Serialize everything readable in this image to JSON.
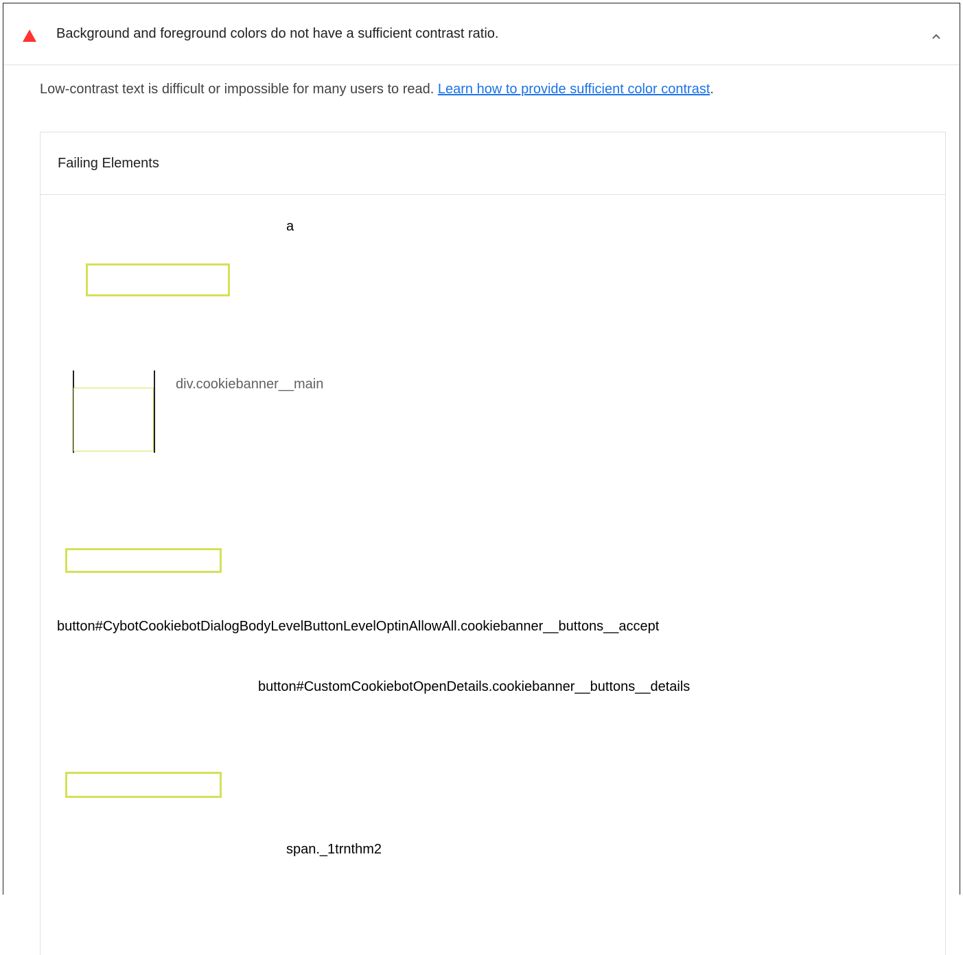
{
  "audit": {
    "title": "Background and foreground colors do not have a sufficient contrast ratio.",
    "status_color": "#ff3333",
    "icon": "fail-triangle-icon",
    "expand_icon": "chevron-up-icon",
    "description_text": "Low-contrast text is difficult or impossible for many users to read. ",
    "description_link": "Learn how to provide sufficient color contrast",
    "description_end": "."
  },
  "details": {
    "header": "Failing Elements",
    "items": [
      {
        "label": "a"
      },
      {
        "label": "div.cookiebanner__main"
      },
      {
        "label": "button#CybotCookiebotDialogBodyLevelButtonLevelOptinAllowAll.cookiebanner__buttons__accept"
      },
      {
        "label": "button#CustomCookiebotOpenDetails.cookiebanner__buttons__details"
      },
      {
        "label": "span._1trnthm2"
      }
    ]
  }
}
